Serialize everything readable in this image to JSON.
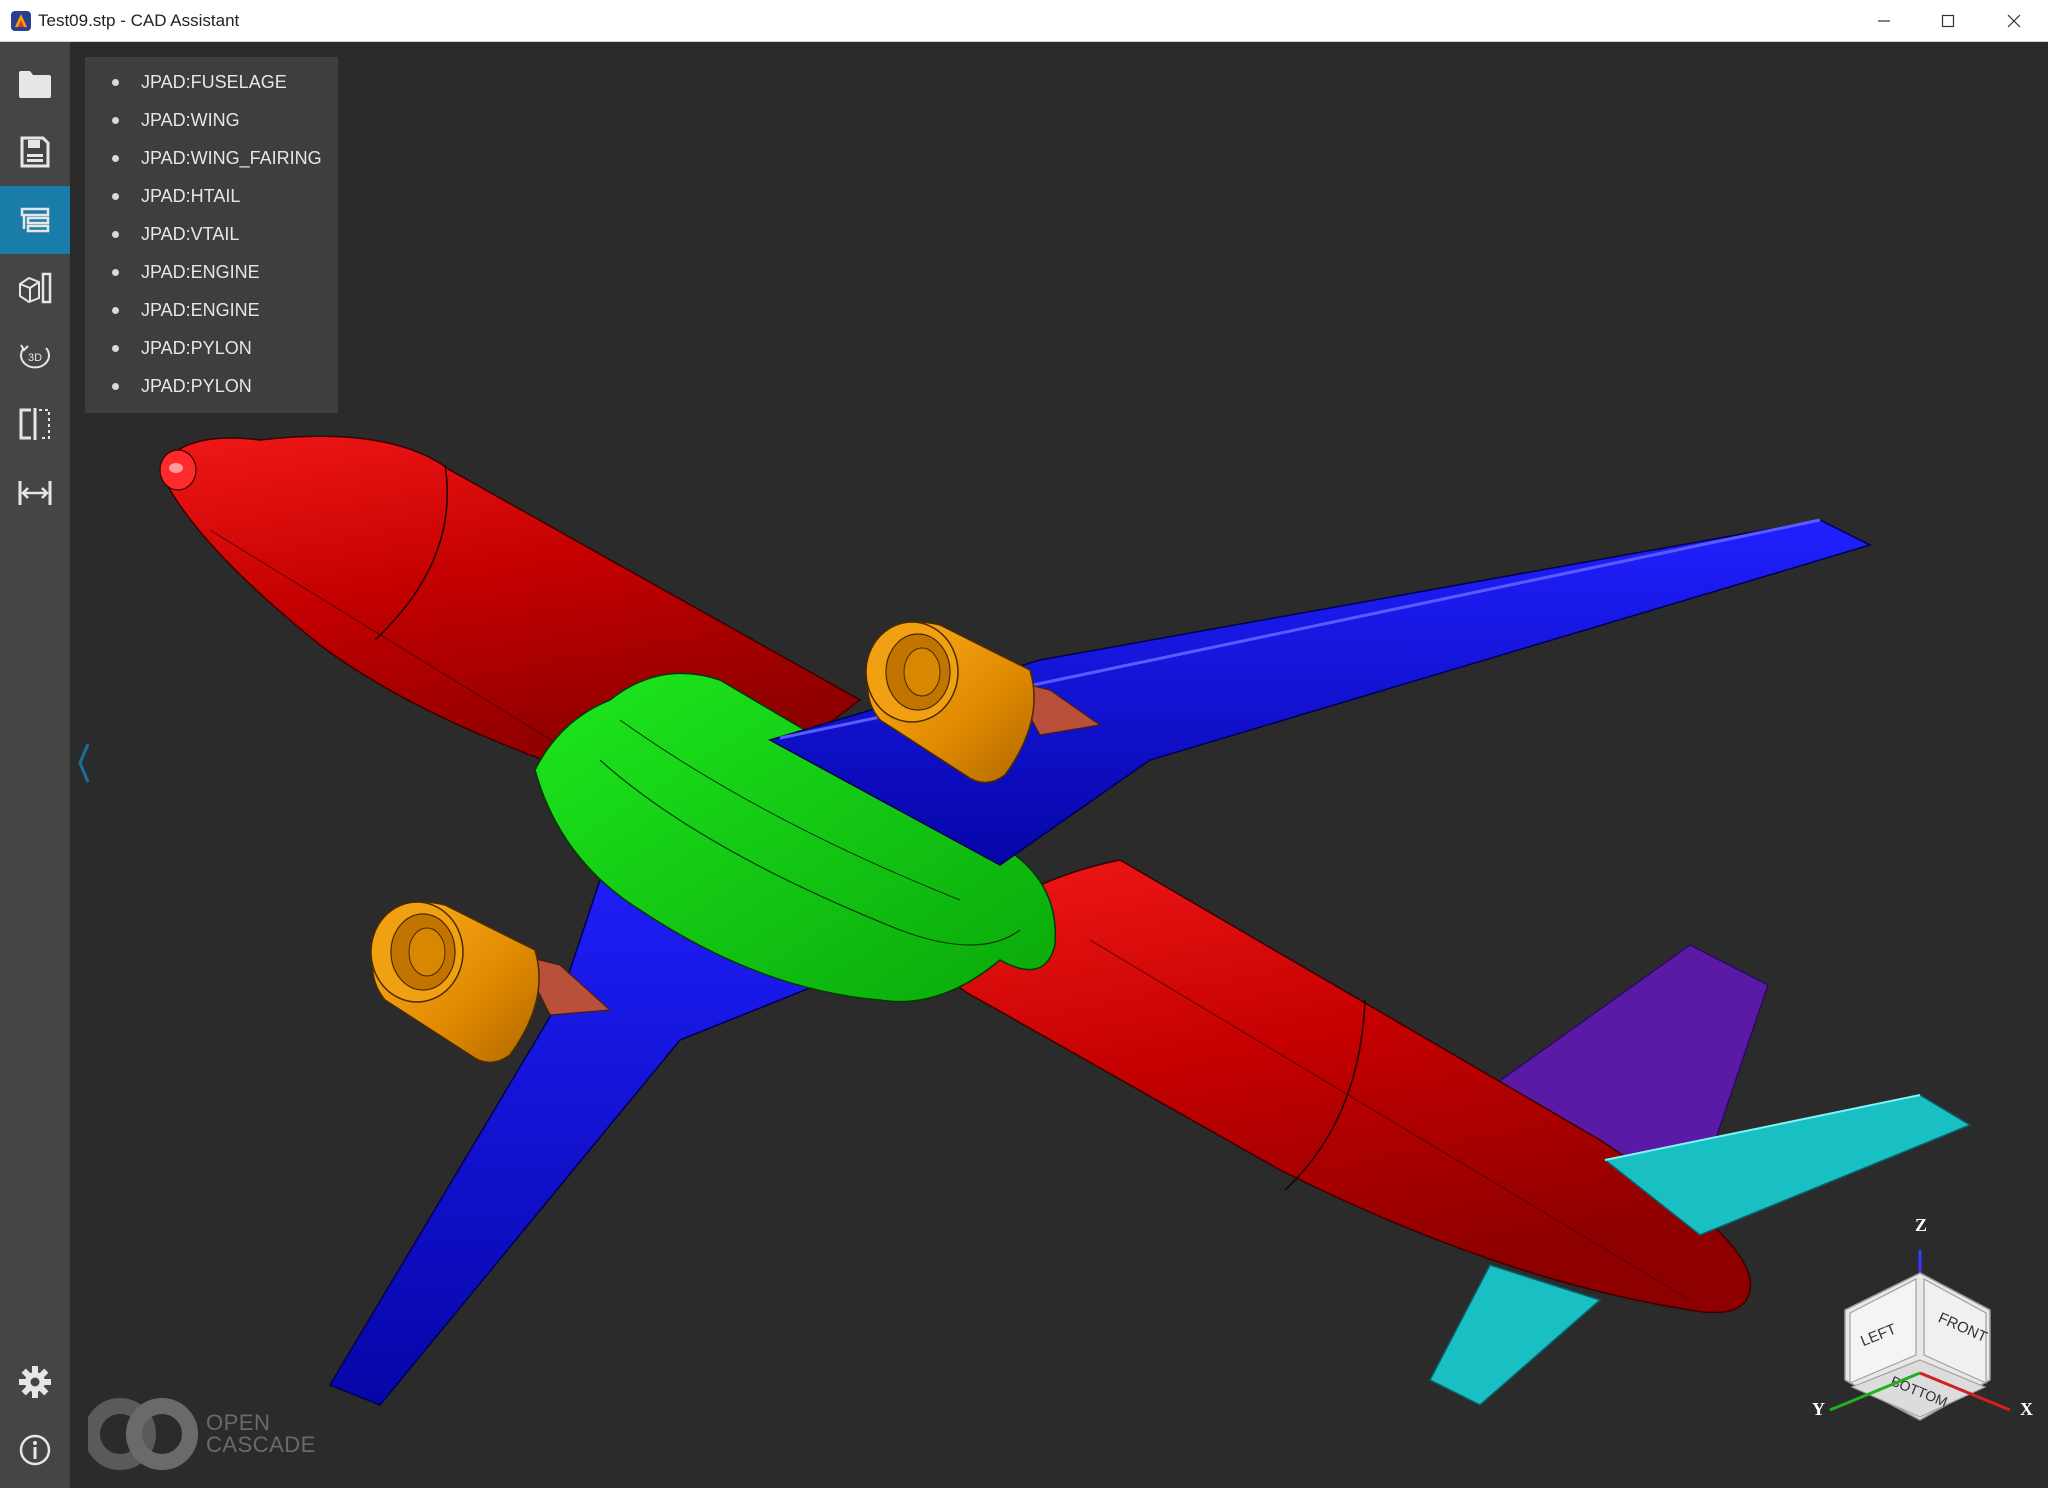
{
  "window": {
    "title": "Test09.stp - CAD Assistant",
    "controls": [
      "minimize",
      "maximize",
      "close"
    ]
  },
  "sidebar": {
    "items": [
      {
        "name": "open",
        "icon": "folder-icon",
        "active": false
      },
      {
        "name": "save",
        "icon": "save-icon",
        "active": false
      },
      {
        "name": "model-tree",
        "icon": "tree-list-icon",
        "active": true
      },
      {
        "name": "display-mode",
        "icon": "shading-icon",
        "active": false
      },
      {
        "name": "view-3d",
        "icon": "rotate-3d-icon",
        "label": "3D",
        "active": false
      },
      {
        "name": "clipping",
        "icon": "clipping-plane-icon",
        "active": false
      },
      {
        "name": "measure",
        "icon": "measure-icon",
        "active": false
      }
    ],
    "bottom_items": [
      {
        "name": "settings",
        "icon": "gear-icon"
      },
      {
        "name": "about",
        "icon": "info-icon"
      }
    ]
  },
  "model_tree": {
    "items": [
      "JPAD:FUSELAGE",
      "JPAD:WING",
      "JPAD:WING_FAIRING",
      "JPAD:HTAIL",
      "JPAD:VTAIL",
      "JPAD:ENGINE",
      "JPAD:ENGINE",
      "JPAD:PYLON",
      "JPAD:PYLON"
    ]
  },
  "model_colors": {
    "fuselage": "#c40000",
    "wing": "#0a0ac8",
    "wing_fairing": "#12c812",
    "htail": "#18c0c4",
    "vtail": "#5a1aa6",
    "engine": "#e08a00",
    "pylon": "#b8503a"
  },
  "watermark": {
    "line1": "OPEN",
    "line2": "CASCADE"
  },
  "view_cube": {
    "faces": {
      "left": "LEFT",
      "front": "FRONT",
      "bottom": "BOTTOM"
    },
    "axes": {
      "z": "Z",
      "y": "Y",
      "x": "X"
    }
  }
}
